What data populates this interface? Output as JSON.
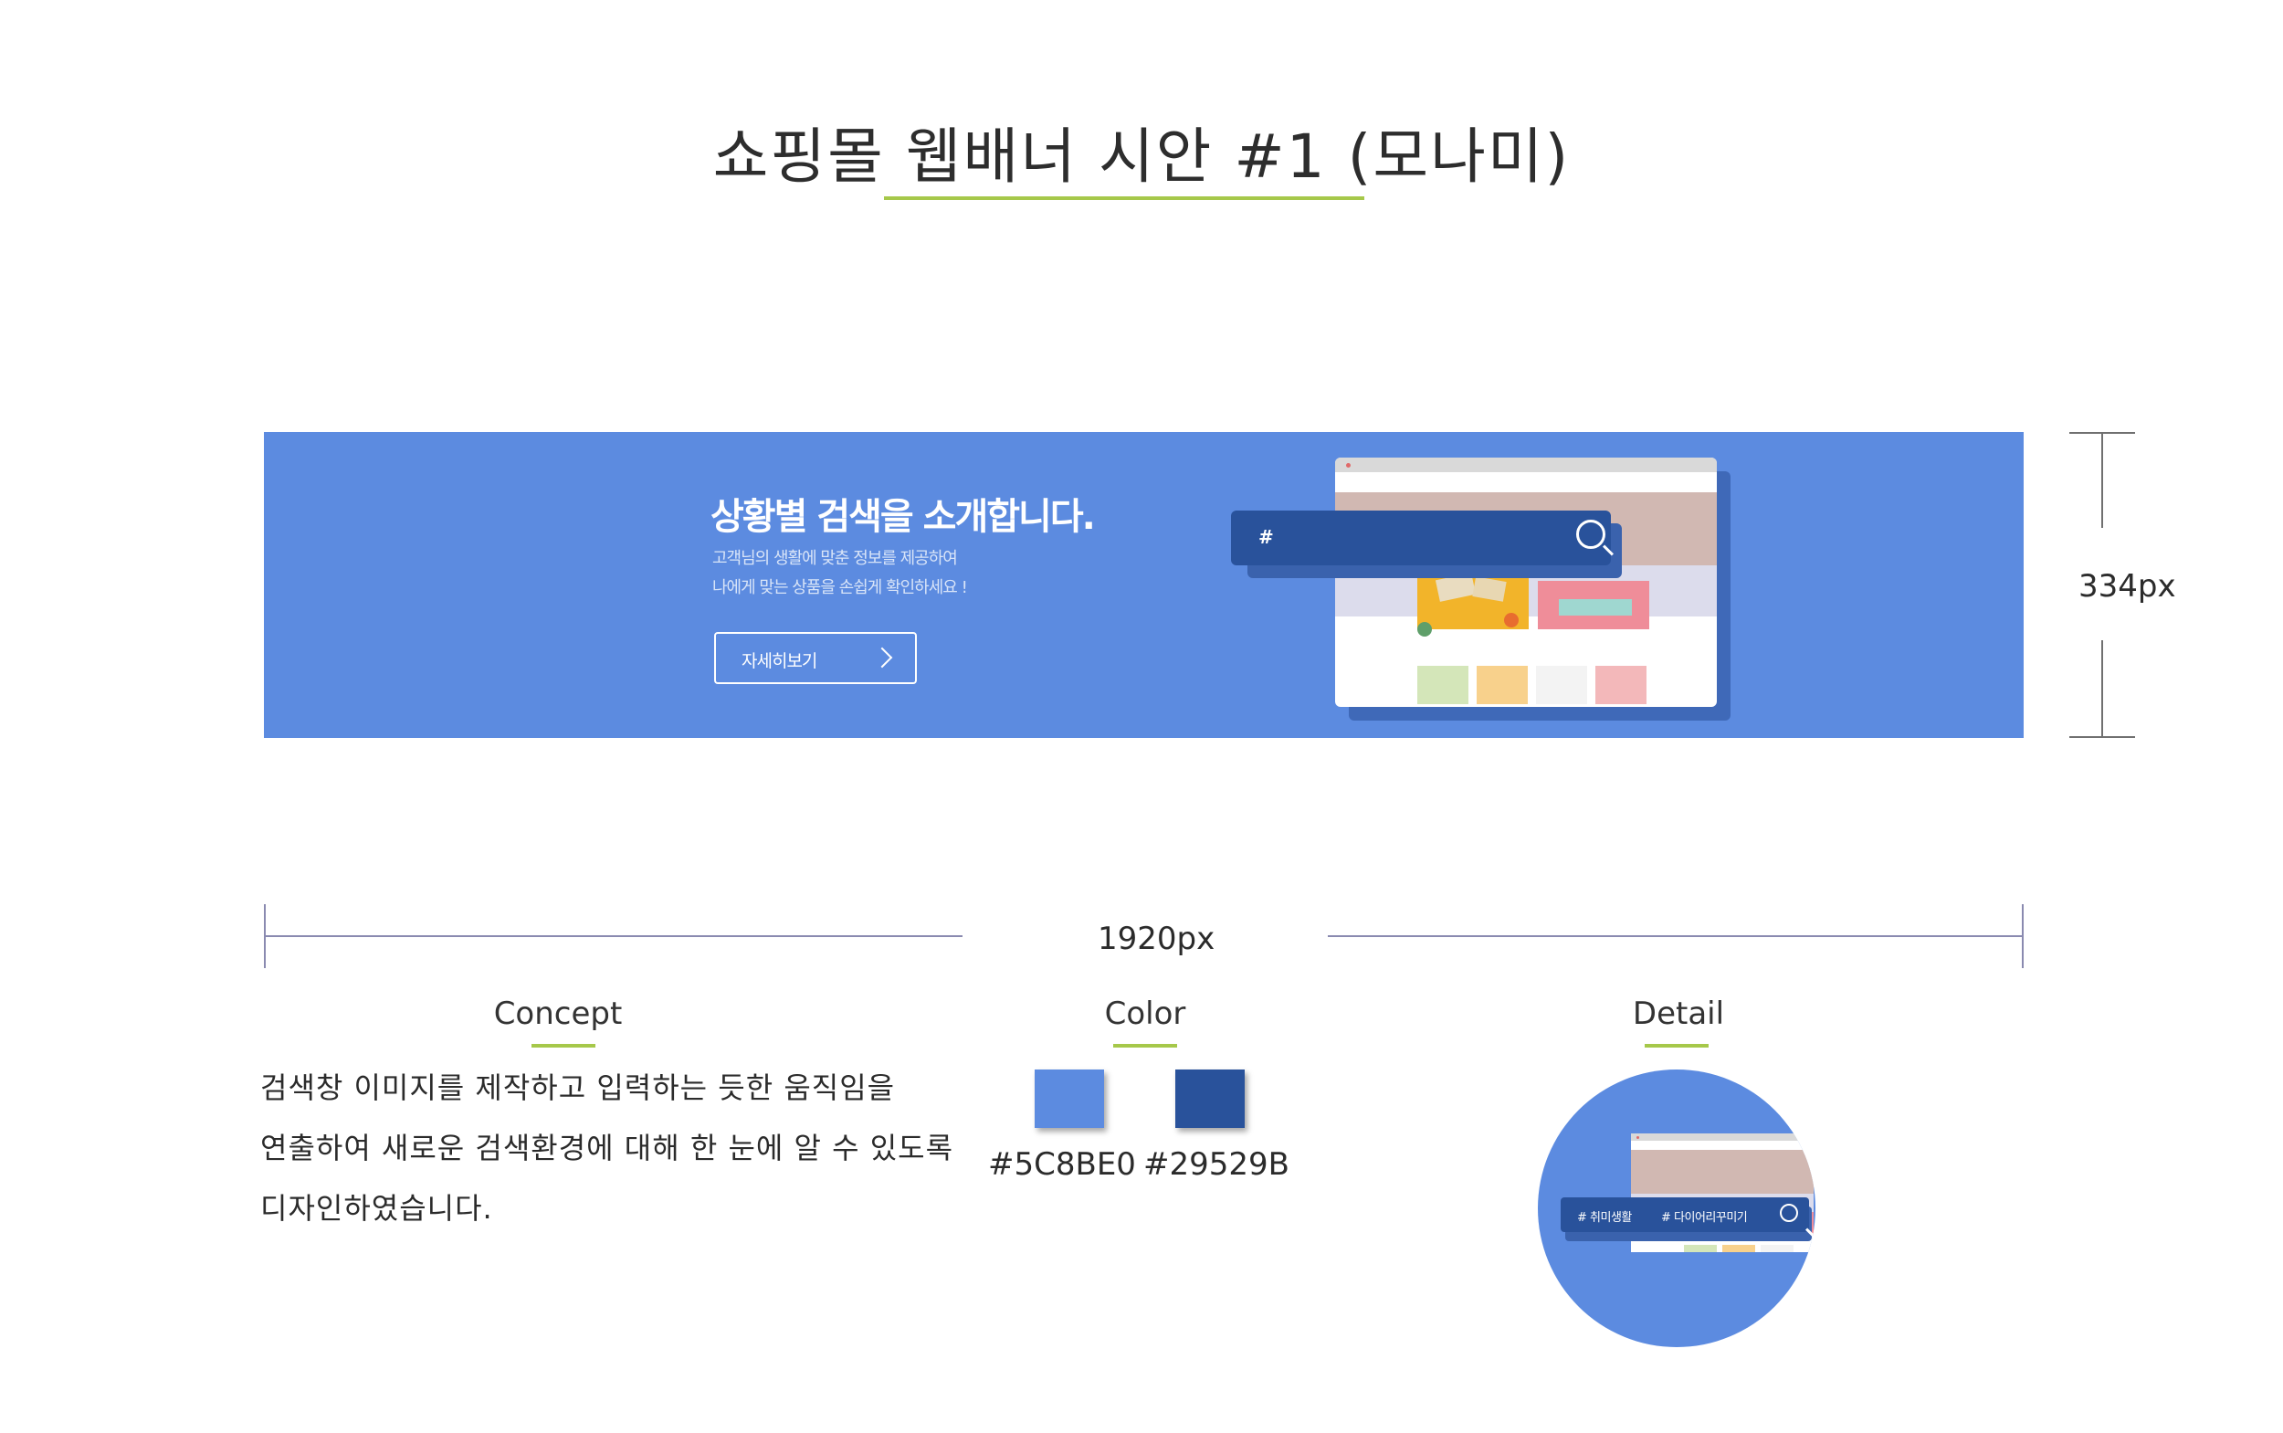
{
  "page": {
    "title": "쇼핑몰 웹배너 시안 #1 (모나미)"
  },
  "banner": {
    "heading": "상황별 검색을 소개합니다.",
    "subtitle_line1": "고객님의 생활에 맞춘 정보를 제공하여",
    "subtitle_line2": "나에게 맞는 상품을 손쉽게 확인하세요 !",
    "button_label": "자세히보기",
    "search_hash": "#",
    "icons": [
      "chevron-right-icon",
      "search-icon"
    ]
  },
  "dimensions": {
    "height_label": "334px",
    "width_label": "1920px"
  },
  "concept": {
    "heading": "Concept",
    "line1": "검색창 이미지를 제작하고 입력하는 듯한 움직임을",
    "line2": "연출하여 새로운 검색환경에 대해 한 눈에 알 수 있도록",
    "line3": "디자인하였습니다."
  },
  "color": {
    "heading": "Color",
    "swatches": [
      {
        "hex": "#5C8BE0"
      },
      {
        "hex": "#29529B"
      }
    ]
  },
  "detail": {
    "heading": "Detail",
    "tag1": "# 취미생활",
    "tag2": "# 다이어리꾸미기"
  },
  "colors": {
    "accent_green": "#a6c84a",
    "banner_blue": "#5c8be0",
    "search_navy": "#29529b"
  }
}
